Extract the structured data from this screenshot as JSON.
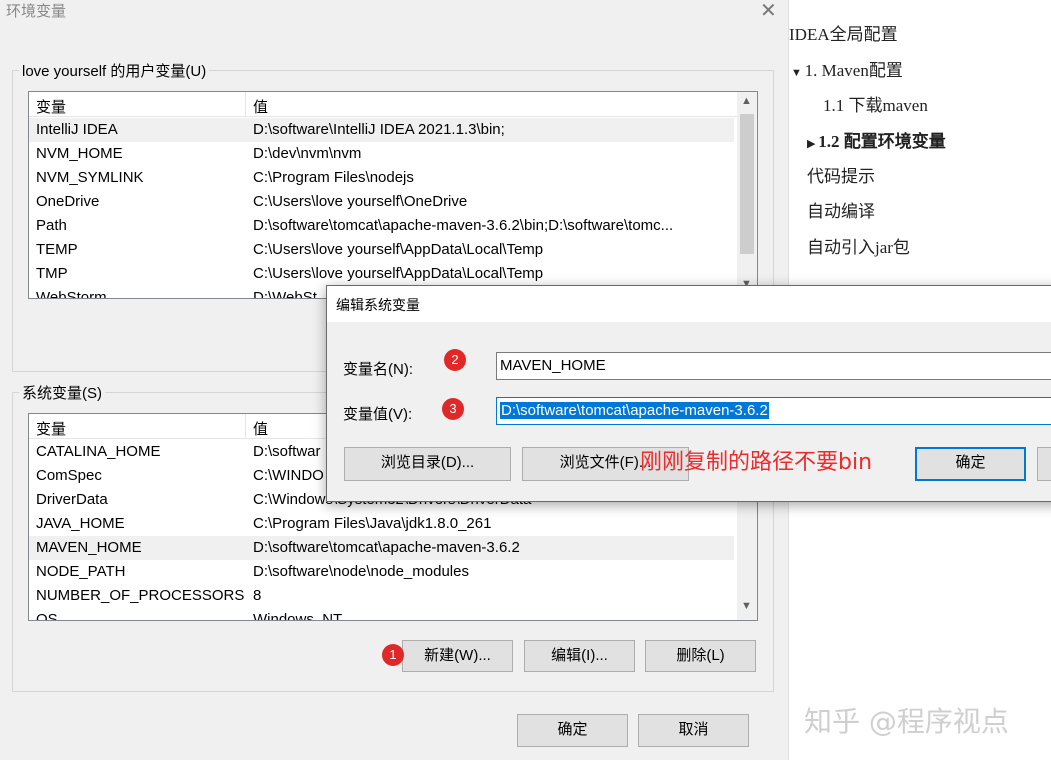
{
  "window": {
    "title": "环境变量",
    "close_icon": "close-icon"
  },
  "user_vars": {
    "legend": "love yourself 的用户变量(U)",
    "col_var": "变量",
    "col_val": "值",
    "rows": [
      {
        "name": "IntelliJ IDEA",
        "value": "D:\\software\\IntelliJ IDEA 2021.1.3\\bin;"
      },
      {
        "name": "NVM_HOME",
        "value": "D:\\dev\\nvm\\nvm"
      },
      {
        "name": "NVM_SYMLINK",
        "value": "C:\\Program Files\\nodejs"
      },
      {
        "name": "OneDrive",
        "value": "C:\\Users\\love yourself\\OneDrive"
      },
      {
        "name": "Path",
        "value": "D:\\software\\tomcat\\apache-maven-3.6.2\\bin;D:\\software\\tomc..."
      },
      {
        "name": "TEMP",
        "value": "C:\\Users\\love yourself\\AppData\\Local\\Temp"
      },
      {
        "name": "TMP",
        "value": "C:\\Users\\love yourself\\AppData\\Local\\Temp"
      },
      {
        "name": "WebStorm",
        "value": "D:\\WebSt"
      }
    ]
  },
  "sys_vars": {
    "legend": "系统变量(S)",
    "col_var": "变量",
    "col_val": "值",
    "rows": [
      {
        "name": "CATALINA_HOME",
        "value": "D:\\softwar"
      },
      {
        "name": "ComSpec",
        "value": "C:\\WINDO"
      },
      {
        "name": "DriverData",
        "value": "C:\\Windows\\System32\\Drivers\\DriverData"
      },
      {
        "name": "JAVA_HOME",
        "value": "C:\\Program Files\\Java\\jdk1.8.0_261"
      },
      {
        "name": "MAVEN_HOME",
        "value": "D:\\software\\tomcat\\apache-maven-3.6.2"
      },
      {
        "name": "NODE_PATH",
        "value": "D:\\software\\node\\node_modules"
      },
      {
        "name": "NUMBER_OF_PROCESSORS",
        "value": "8"
      },
      {
        "name": "OS",
        "value": "Windows_NT"
      }
    ],
    "buttons": {
      "new": "新建(W)...",
      "edit": "编辑(I)...",
      "delete": "删除(L)"
    }
  },
  "footer": {
    "ok": "确定",
    "cancel": "取消"
  },
  "badges": {
    "b1": "1",
    "b2": "2",
    "b3": "3"
  },
  "edit_dialog": {
    "title": "编辑系统变量",
    "name_label": "变量名(N):",
    "value_label": "变量值(V):",
    "name_value": "MAVEN_HOME",
    "value_value": "D:\\software\\tomcat\\apache-maven-3.6.2",
    "browse_dir": "浏览目录(D)...",
    "browse_file": "浏览文件(F)...",
    "ok": "确定"
  },
  "annotation": "刚刚复制的路径不要bin",
  "sidebar": {
    "items": [
      {
        "label": "IDEA全局配置"
      },
      {
        "label": "1. Maven配置"
      },
      {
        "label": "1.1 下载maven"
      },
      {
        "label": "1.2 配置环境变量"
      },
      {
        "label": "代码提示"
      },
      {
        "label": "自动编译"
      },
      {
        "label": "自动引入jar包"
      }
    ]
  },
  "watermark": "知乎 @程序视点",
  "colors": {
    "accent": "#0078d7",
    "badge": "#e02828",
    "annotation": "#ef2a2a"
  }
}
